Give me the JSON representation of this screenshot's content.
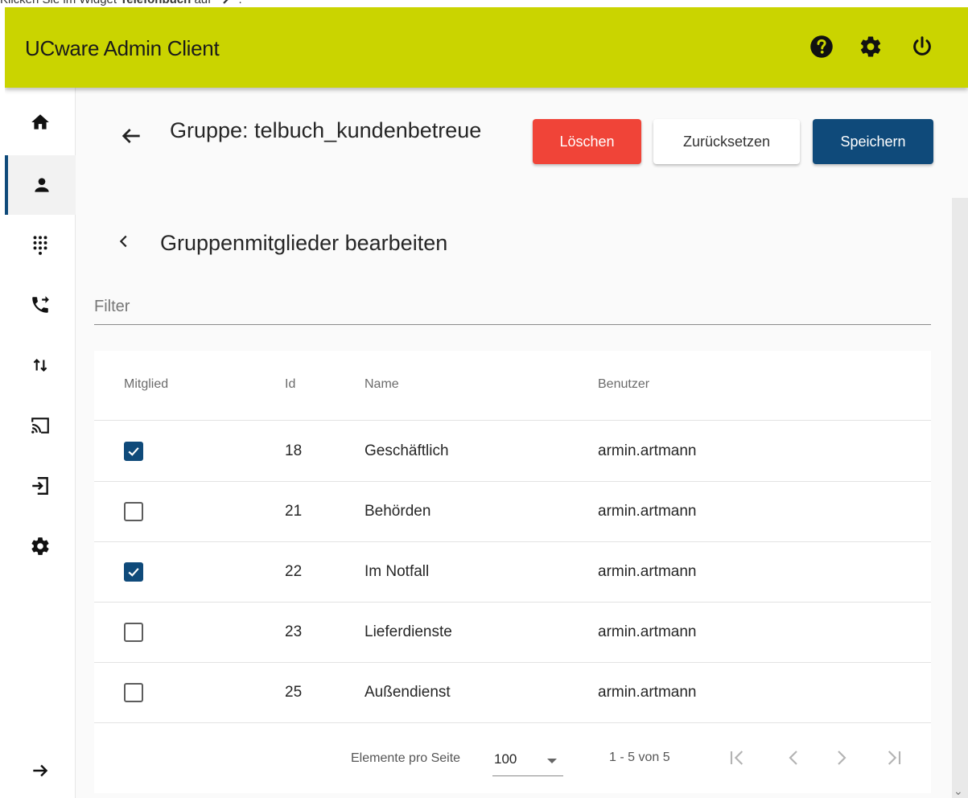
{
  "doc_instruction": {
    "prefix": "Klicken Sie im Widget ",
    "bold": "Telefonbuch",
    "suffix": " auf",
    "icon": "arrow-icon"
  },
  "app": {
    "title": "UCware Admin Client",
    "accent_color": "#cad400",
    "primary_color": "#0f4a7a",
    "danger_color": "#f04438"
  },
  "top_icons": [
    "help-icon",
    "settings-icon",
    "power-icon"
  ],
  "sidebar": {
    "items": [
      {
        "icon": "home-icon",
        "active": false
      },
      {
        "icon": "user-icon",
        "active": true
      },
      {
        "icon": "dialpad-icon",
        "active": false
      },
      {
        "icon": "call-forward-icon",
        "active": false
      },
      {
        "icon": "swap-vertical-icon",
        "active": false
      },
      {
        "icon": "cast-icon",
        "active": false
      },
      {
        "icon": "login-icon",
        "active": false
      },
      {
        "icon": "settings-icon",
        "active": false
      }
    ],
    "expand_icon": "arrow-right-icon"
  },
  "header": {
    "title": "Gruppe: telbuch_kundenbetreue",
    "delete_label": "Löschen",
    "reset_label": "Zurücksetzen",
    "save_label": "Speichern"
  },
  "section": {
    "title": "Gruppenmitglieder bearbeiten"
  },
  "filter": {
    "placeholder": "Filter",
    "value": ""
  },
  "table": {
    "headers": {
      "member": "Mitglied",
      "id": "Id",
      "name": "Name",
      "user": "Benutzer"
    },
    "rows": [
      {
        "checked": true,
        "id": "18",
        "name": "Geschäftlich",
        "user": "armin.artmann"
      },
      {
        "checked": false,
        "id": "21",
        "name": "Behörden",
        "user": "armin.artmann"
      },
      {
        "checked": true,
        "id": "22",
        "name": "Im Notfall",
        "user": "armin.artmann"
      },
      {
        "checked": false,
        "id": "23",
        "name": "Lieferdienste",
        "user": "armin.artmann"
      },
      {
        "checked": false,
        "id": "25",
        "name": "Außendienst",
        "user": "armin.artmann"
      }
    ]
  },
  "pagination": {
    "per_page_label": "Elemente pro Seite",
    "per_page_value": "100",
    "range": "1 - 5 von 5"
  }
}
